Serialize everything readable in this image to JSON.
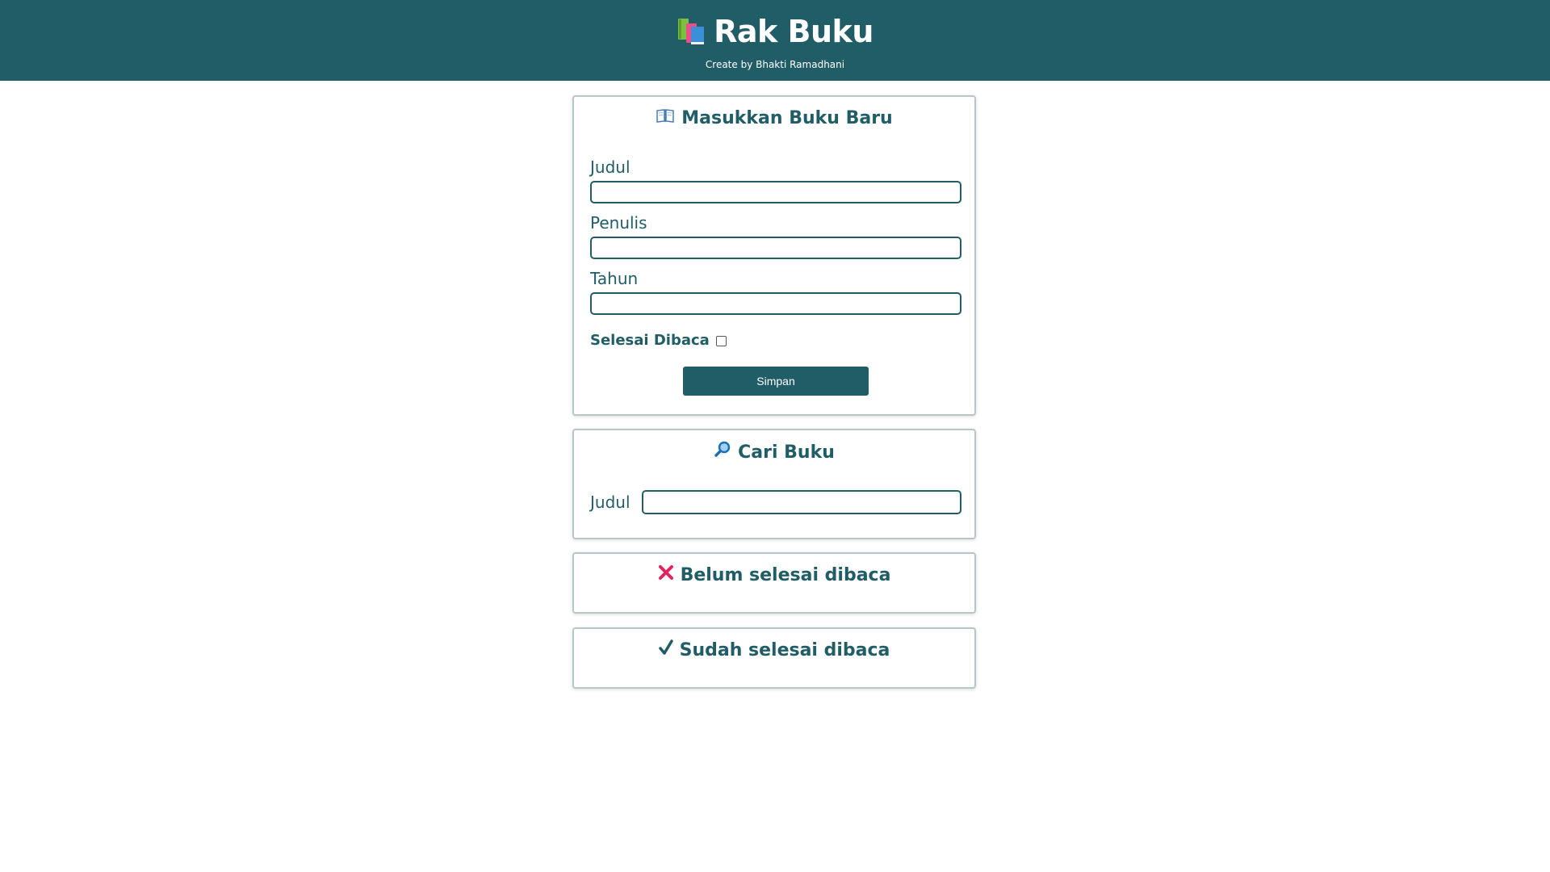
{
  "header": {
    "title": "Rak Buku",
    "subtitle": "Create by Bhakti Ramadhani",
    "icon": "books-icon"
  },
  "add_book": {
    "title": "Masukkan Buku Baru",
    "icon": "open-book-icon",
    "title_label": "Judul",
    "title_value": "",
    "author_label": "Penulis",
    "author_value": "",
    "year_label": "Tahun",
    "year_value": "",
    "finished_label": "Selesai Dibaca",
    "finished_checked": false,
    "submit_label": "Simpan"
  },
  "search": {
    "title": "Cari Buku",
    "icon": "magnifier-icon",
    "title_label": "Judul",
    "title_value": ""
  },
  "unfinished": {
    "title": "Belum selesai dibaca",
    "icon": "cross-mark-icon"
  },
  "finished": {
    "title": "Sudah selesai dibaca",
    "icon": "check-mark-icon"
  },
  "colors": {
    "primary": "#205d66",
    "card_border": "#b6c7cb",
    "cross": "#e0245e"
  }
}
